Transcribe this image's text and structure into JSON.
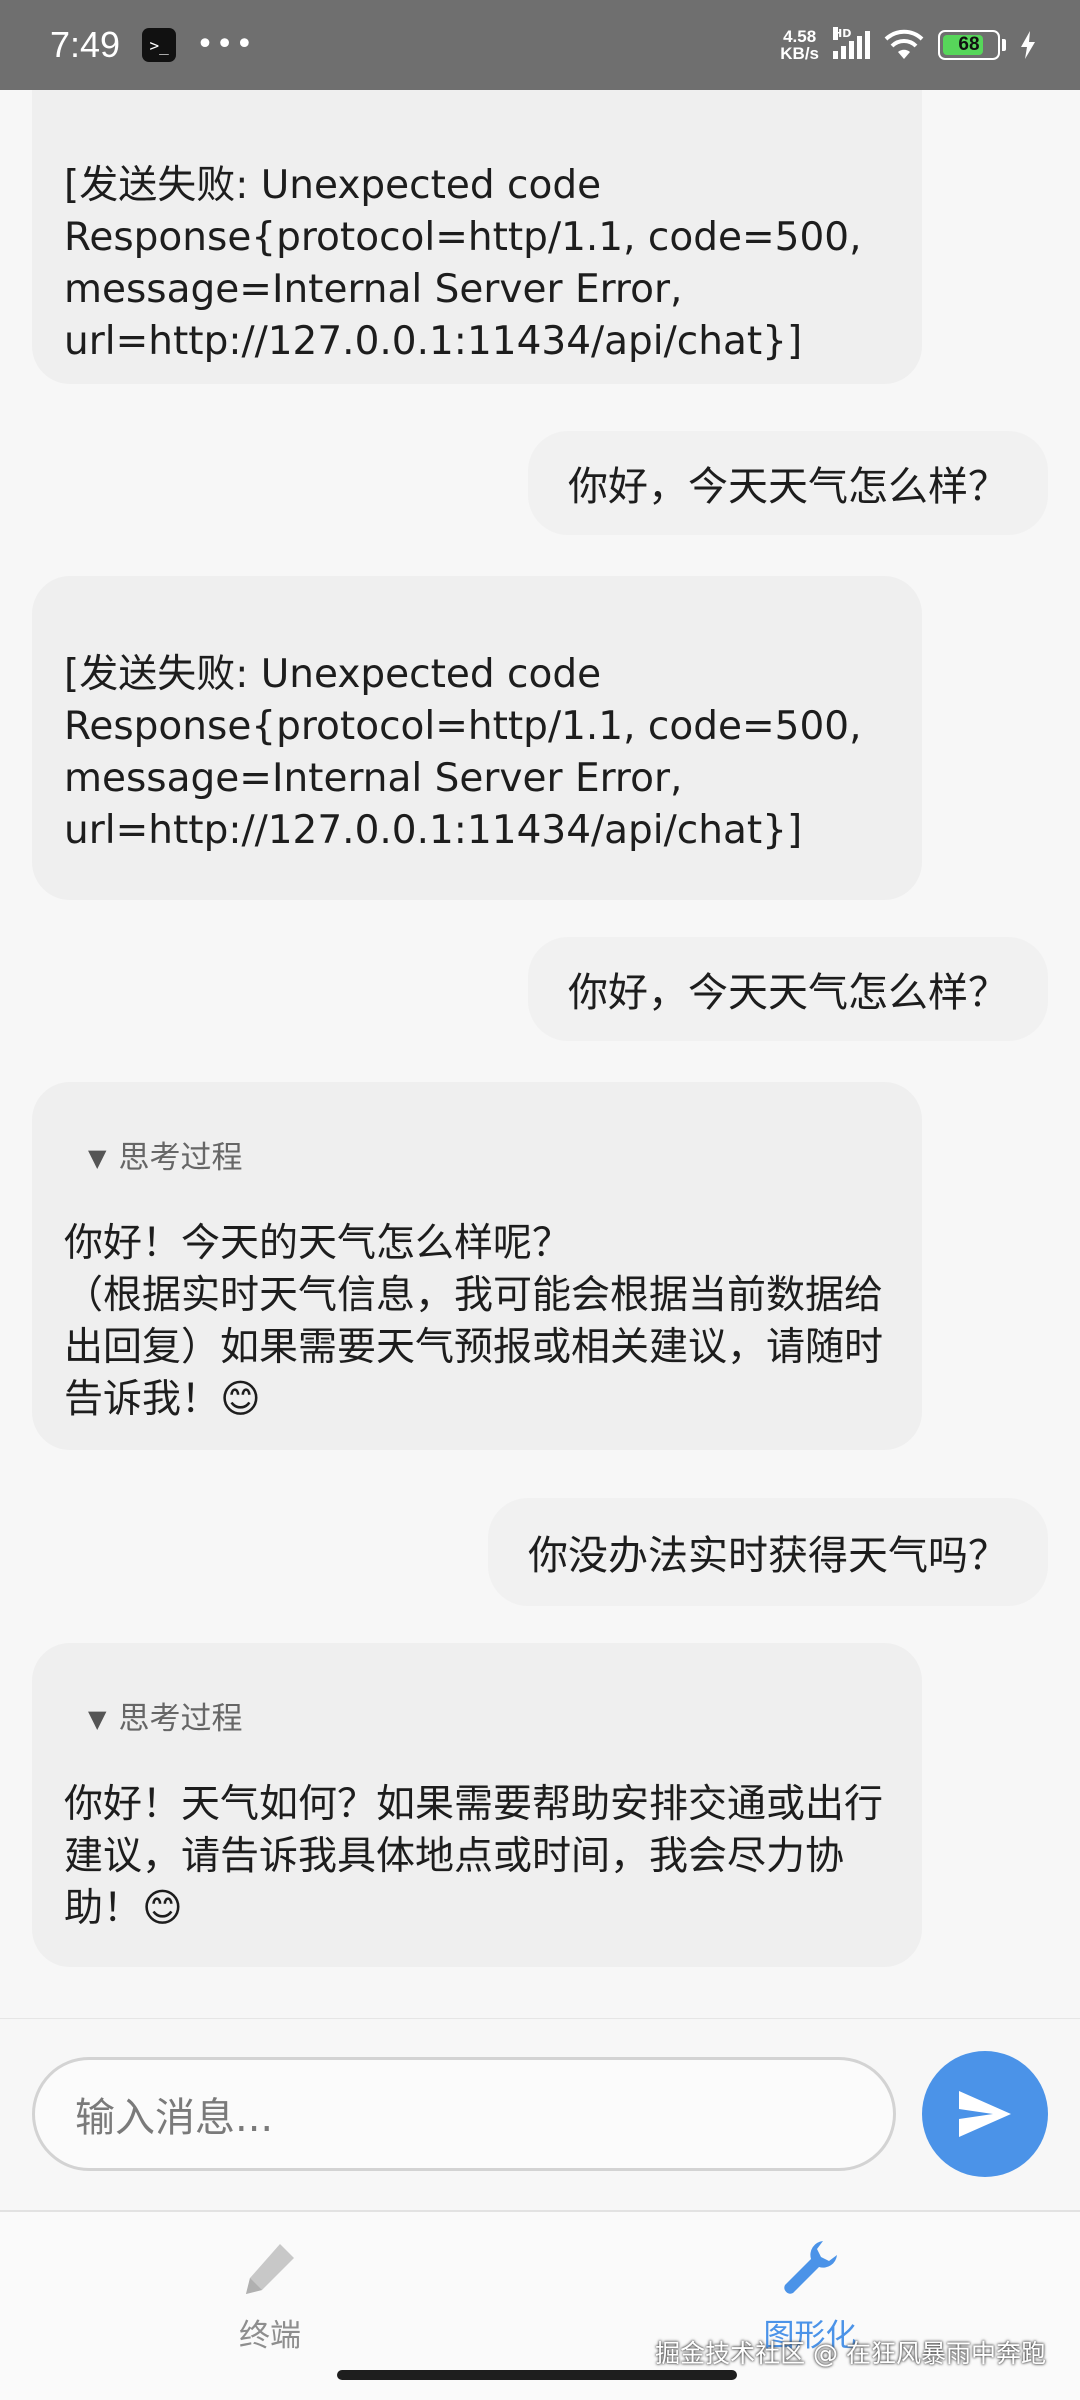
{
  "status_bar": {
    "time": "7:49",
    "terminal_glyph": ">_",
    "more_glyph": "•••",
    "net_speed_value": "4.58",
    "net_speed_unit": "KB/s",
    "hd_label": "HD",
    "battery_level": "68"
  },
  "messages": [
    {
      "role": "ai",
      "text": "[发送失败: Unexpected code\nResponse{protocol=http/1.1, code=500,\nmessage=Internal Server Error,\nurl=http://127.0.0.1:11434/api/chat}]"
    },
    {
      "role": "user",
      "text": "你好，今天天气怎么样？"
    },
    {
      "role": "ai",
      "text": "[发送失败: Unexpected code\nResponse{protocol=http/1.1, code=500,\nmessage=Internal Server Error,\nurl=http://127.0.0.1:11434/api/chat}]"
    },
    {
      "role": "user",
      "text": "你好，今天天气怎么样？"
    },
    {
      "role": "ai",
      "thinking_label": "思考过程",
      "text": "你好！今天的天气怎么样呢？\n（根据实时天气信息，我可能会根据当前数据给\n出回复）如果需要天气预报或相关建议，请随时\n告诉我！😊"
    },
    {
      "role": "user",
      "text": "你没办法实时获得天气吗？"
    },
    {
      "role": "ai",
      "thinking_label": "思考过程",
      "text": "你好！天气如何？如果需要帮助安排交通或出行\n建议，请告诉我具体地点或时间，我会尽力协\n助！😊"
    }
  ],
  "input": {
    "placeholder": "输入消息..."
  },
  "nav": {
    "terminal_label": "终端",
    "graphic_label": "图形化"
  },
  "watermark": "掘金技术社区 @ 在狂风暴雨中奔跑",
  "colors": {
    "accent": "#4b93e8",
    "ai_bubble": "#efefef",
    "status_bar": "#6f6f6f"
  }
}
